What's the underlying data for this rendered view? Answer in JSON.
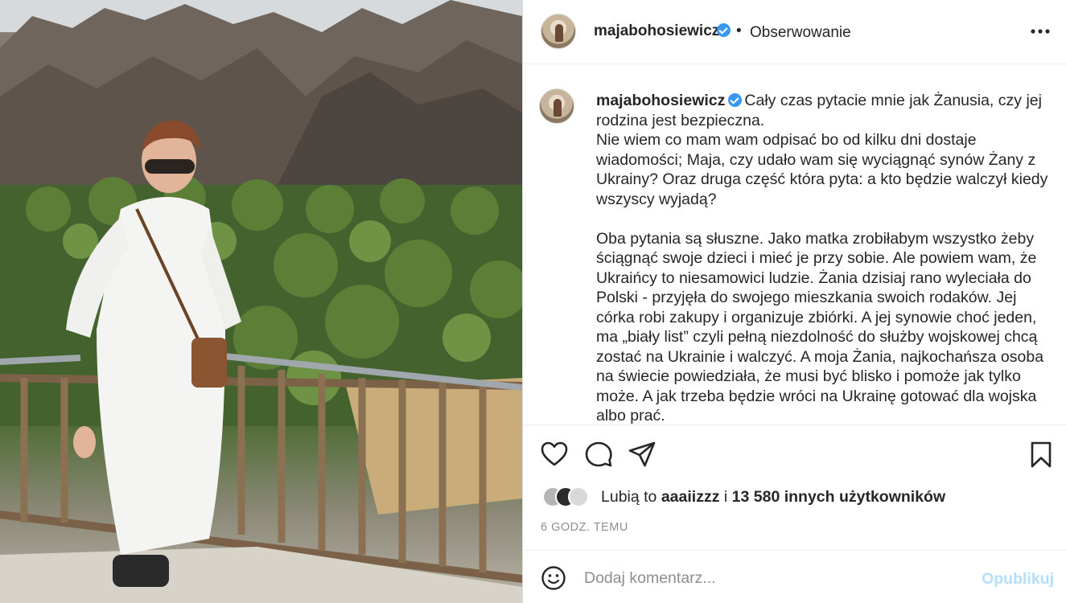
{
  "post": {
    "image_alt": "Zdjęcie"
  },
  "header": {
    "username": "majabohosiewicz",
    "separator": "•",
    "follow_status": "Obserwowanie",
    "more_icon": "more-horizontal-icon"
  },
  "caption": {
    "username": "majabohosiewicz",
    "para1": "Cały czas pytacie mnie jak Żanusia, czy jej rodzina jest bezpieczna.\nNie wiem co mam wam odpisać bo od kilku dni dostaje wiadomości; Maja, czy udało wam się wyciągnąć synów Żany z Ukrainy? Oraz druga część która pyta: a kto będzie walczył kiedy wszyscy wyjadą?",
    "para2": "Oba pytania są słuszne. Jako matka zrobiłabym wszystko żeby ściągnąć swoje dzieci i mieć je przy sobie. Ale powiem wam, że Ukraińcy to niesamowici ludzie. Żania dzisiaj rano wyleciała do Polski - przyjęła do swojego mieszkania swoich rodaków. Jej córka robi zakupy i organizuje zbiórki. A jej synowie choć jeden, ma „biały list” czyli pełną niezdolność do służby wojskowej chcą zostać na Ukrainie i walczyć. A moja Żania, najkochańsza osoba na świecie powiedziała, że musi być blisko i pomoże jak tylko może. A jak trzeba będzie wróci na Ukrainę gotować dla wojska albo prać.\nA ja leżę na łóżku i płaczę - bo okrucieństwo świata mnie przytłacza"
  },
  "actions": {
    "icons": [
      "heart-icon",
      "comment-icon",
      "share-icon",
      "bookmark-icon"
    ]
  },
  "likes": {
    "prefix": "Lubią to",
    "user": "aaaiizzz",
    "joiner": "i",
    "others": "13 580 innych użytkowników"
  },
  "timestamp": "6 godz. temu",
  "comment": {
    "placeholder": "Dodaj komentarz...",
    "publish_label": "Opublikuj",
    "publish_color": "#b2dffc"
  },
  "colors": {
    "text": "#262626",
    "muted": "#8e8e8e",
    "verified": "#3897f0",
    "border": "#dbdbdb"
  }
}
